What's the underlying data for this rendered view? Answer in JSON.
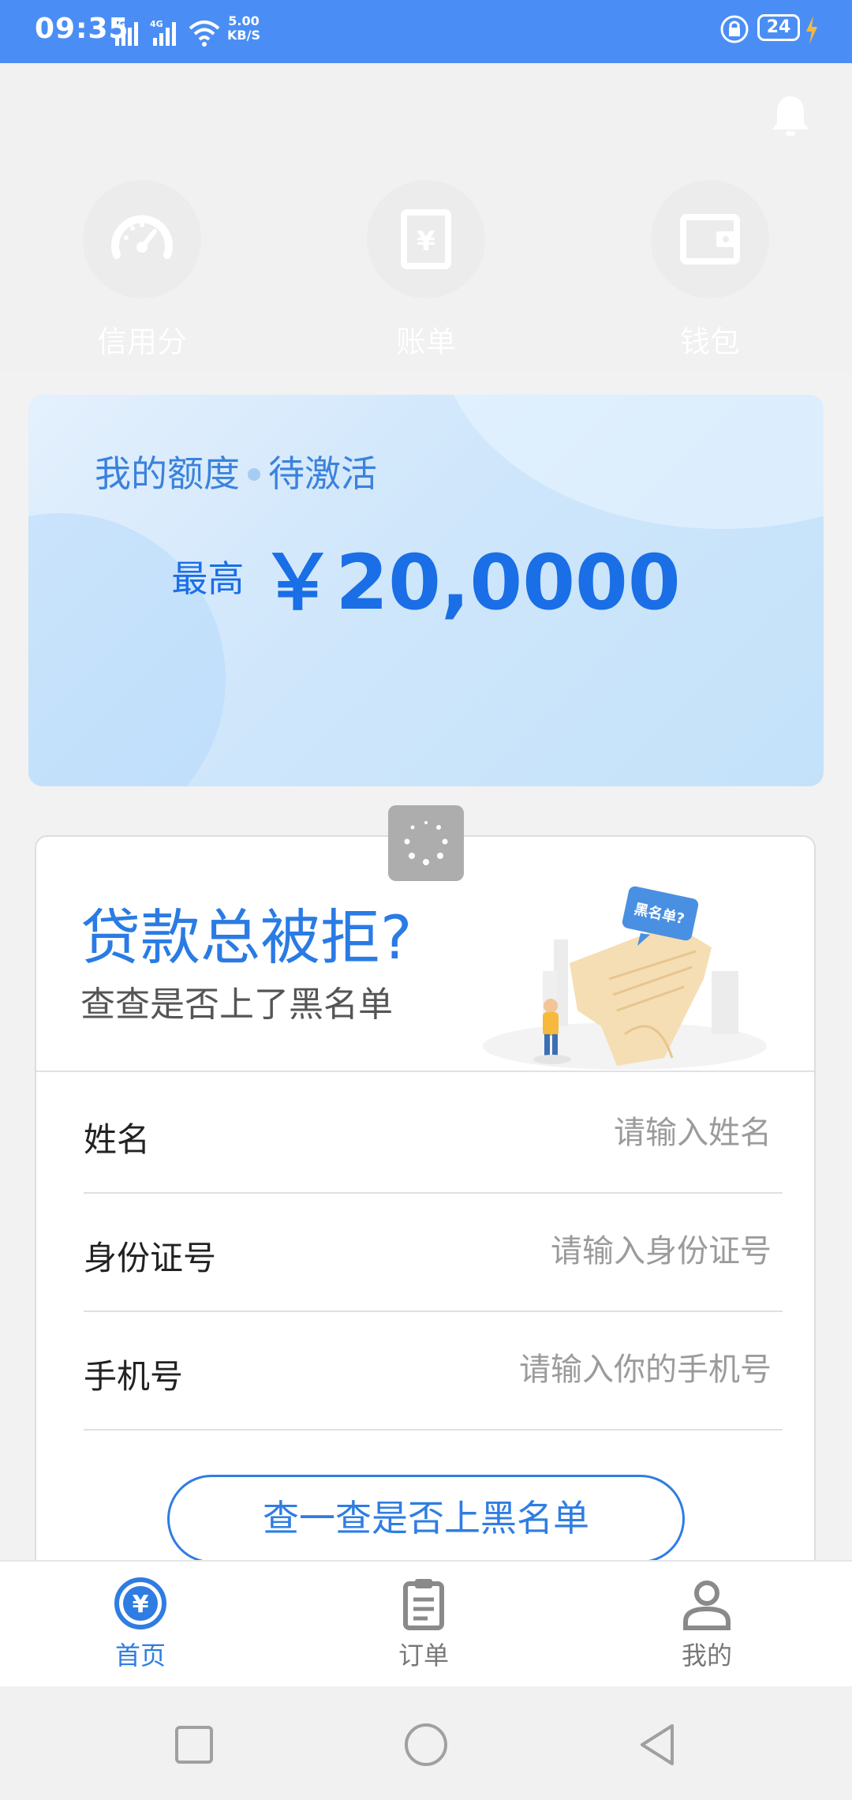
{
  "status_bar": {
    "time": "09:35",
    "signal1": "4G",
    "signal2": "4G",
    "net_speed_value": "5.00",
    "net_speed_unit": "KB/S",
    "battery": "24"
  },
  "nav": [
    {
      "label": "信用分",
      "icon": "speedometer-icon"
    },
    {
      "label": "账单",
      "icon": "bill-icon"
    },
    {
      "label": "钱包",
      "icon": "wallet-icon"
    }
  ],
  "quota": {
    "title": "我的额度",
    "status": "待激活",
    "prefix": "最高",
    "amount": "￥20,0000"
  },
  "blacklist": {
    "title": "贷款总被拒?",
    "subtitle": "查查是否上了黑名单",
    "badge": "黑名单?",
    "fields": [
      {
        "label": "姓名",
        "placeholder": "请输入姓名"
      },
      {
        "label": "身份证号",
        "placeholder": "请输入身份证号"
      },
      {
        "label": "手机号",
        "placeholder": "请输入你的手机号"
      }
    ],
    "button": "查一查是否上黑名单"
  },
  "tabs": [
    {
      "label": "首页",
      "active": true
    },
    {
      "label": "订单",
      "active": false
    },
    {
      "label": "我的",
      "active": false
    }
  ],
  "colors": {
    "accent": "#2f7de2",
    "status_bar": "#4a8ef5"
  }
}
